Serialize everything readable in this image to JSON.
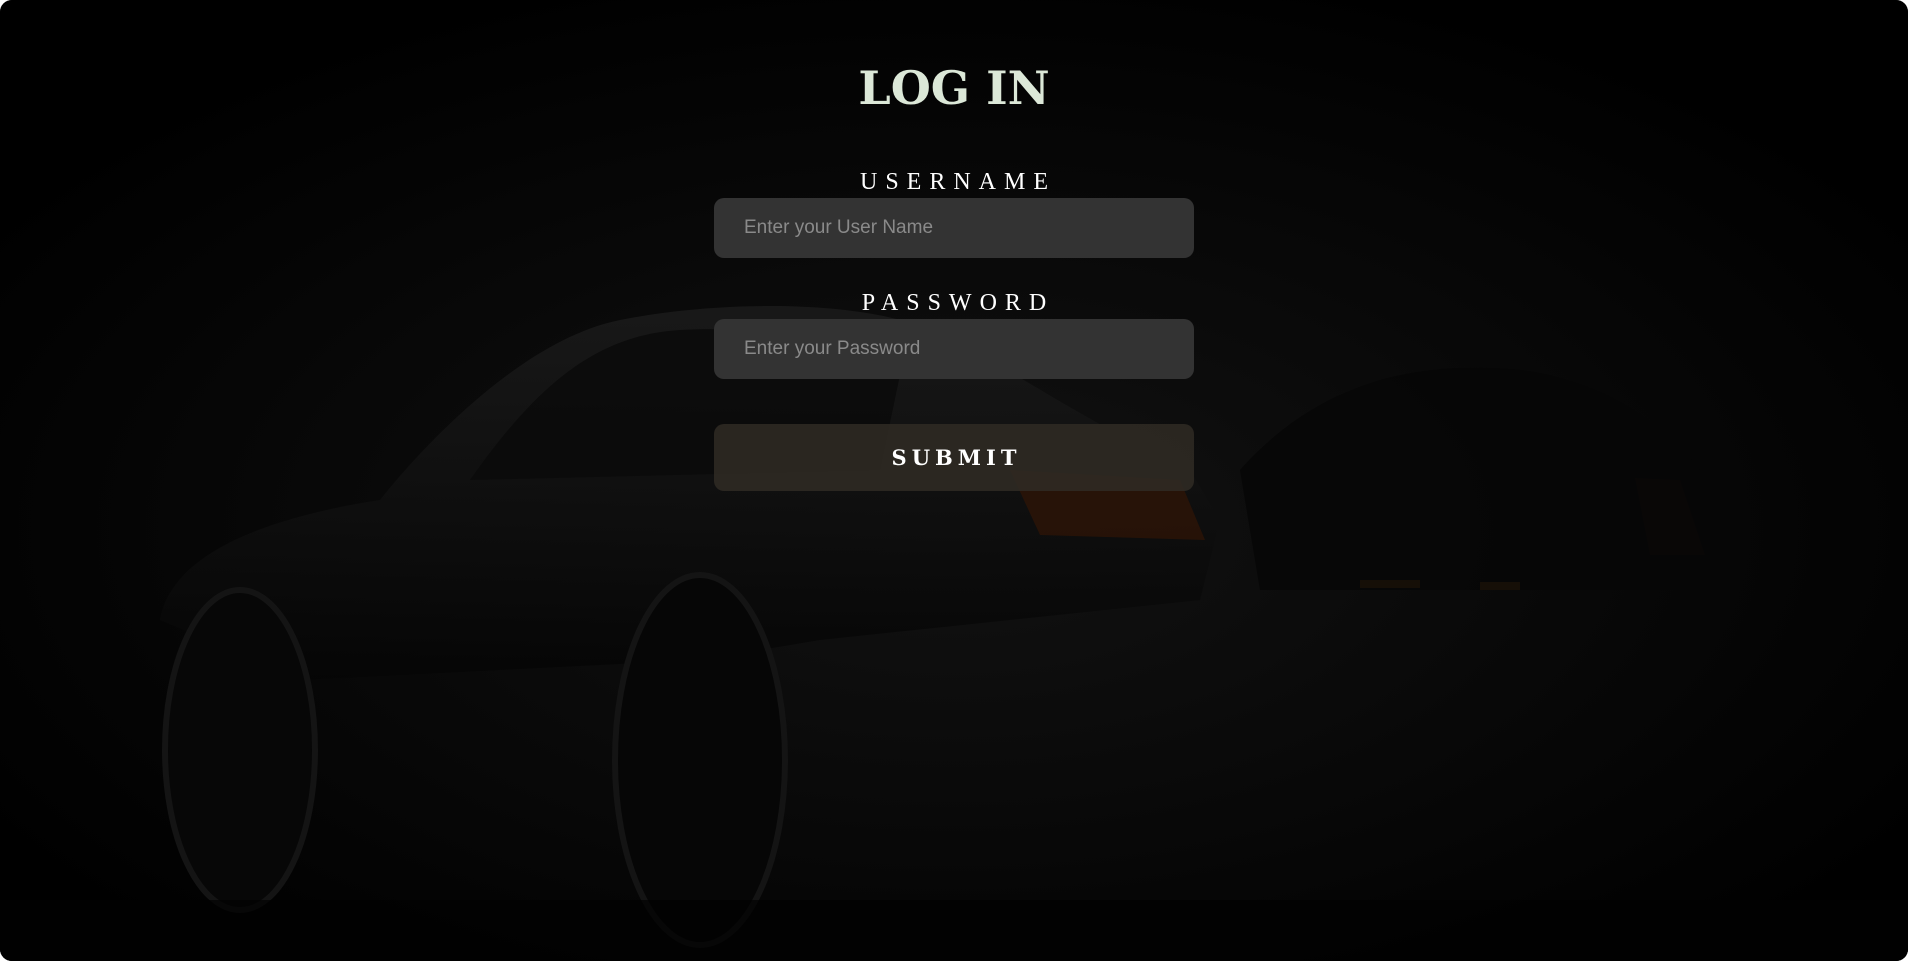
{
  "page": {
    "title": "LOG IN"
  },
  "form": {
    "username": {
      "label": "USERNAME",
      "placeholder": "Enter your User Name",
      "value": ""
    },
    "password": {
      "label": "PASSWORD",
      "placeholder": "Enter your Password",
      "value": ""
    },
    "submit_label": "SUBMIT"
  },
  "colors": {
    "background": "#000000",
    "title": "#dce8d8",
    "label": "#ffffff",
    "input_background": "#333333",
    "placeholder": "#8a8a8a",
    "submit_background": "#302c24"
  }
}
